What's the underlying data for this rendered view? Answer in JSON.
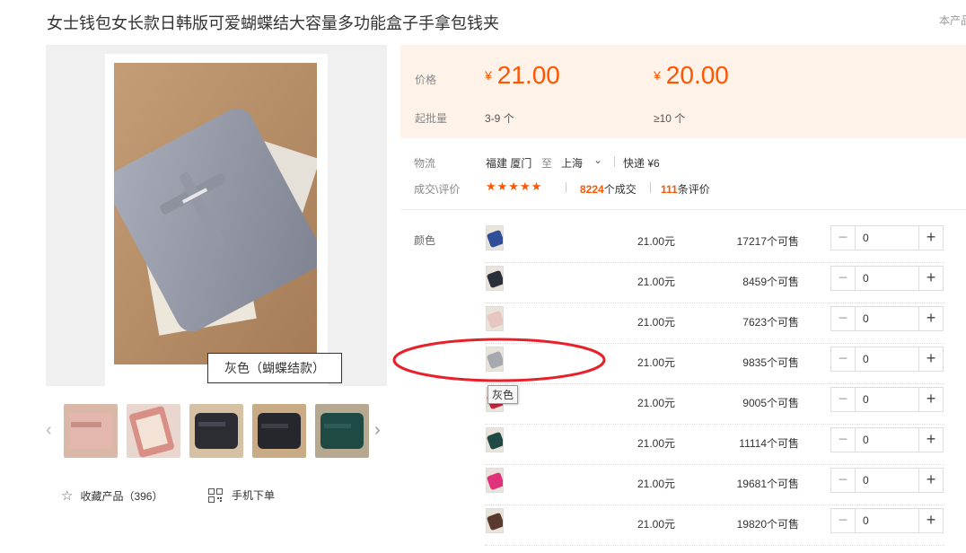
{
  "title": "女士钱包女长款日韩版可爱蝴蝶结大容量多功能盒子手拿包钱夹",
  "report_link": "本产品",
  "gallery": {
    "caption": "灰色（蝴蝶结款）",
    "thumbnails": [
      {
        "name": "pink-wallet"
      },
      {
        "name": "pink-open-wallet"
      },
      {
        "name": "black-wallet"
      },
      {
        "name": "black-wallet-2"
      },
      {
        "name": "green-wallet"
      }
    ]
  },
  "collect": {
    "label": "收藏产品（396）"
  },
  "mobile_order": {
    "label": "手机下单"
  },
  "price_panel": {
    "price_label": "价格",
    "moq_label": "起批量",
    "tiers": [
      {
        "currency": "¥",
        "price": "21.00",
        "range": "3-9 个"
      },
      {
        "currency": "¥",
        "price": "20.00",
        "range": "≥10 个"
      }
    ]
  },
  "logistics": {
    "label": "物流",
    "from": "福建 厦门",
    "to_word": "至",
    "dest": "上海",
    "express": "快递 ¥6"
  },
  "deals": {
    "label": "成交\\评价",
    "stars": "★★★★★",
    "deals_count": "8224",
    "deals_suffix": "个成交",
    "reviews_count": "111",
    "reviews_suffix": "条评价"
  },
  "variants": {
    "label": "颜色",
    "tooltip": "灰色",
    "rows": [
      {
        "color": "#2f4f9a",
        "price": "21.00元",
        "stock": "17217个可售",
        "qty": "0"
      },
      {
        "color": "#2b2f3a",
        "price": "21.00元",
        "stock": "8459个可售",
        "qty": "0"
      },
      {
        "color": "#e8c6c0",
        "price": "21.00元",
        "stock": "7623个可售",
        "qty": "0"
      },
      {
        "color": "#a7a9b0",
        "price": "21.00元",
        "stock": "9835个可售",
        "qty": "0"
      },
      {
        "color": "#c2263a",
        "price": "21.00元",
        "stock": "9005个可售",
        "qty": "0"
      },
      {
        "color": "#1f4a44",
        "price": "21.00元",
        "stock": "11114个可售",
        "qty": "0"
      },
      {
        "color": "#e0327a",
        "price": "21.00元",
        "stock": "19681个可售",
        "qty": "0"
      },
      {
        "color": "#5a3a2c",
        "price": "21.00元",
        "stock": "19820个可售",
        "qty": "0"
      }
    ]
  },
  "colors": {
    "accent": "#ff5500",
    "panel_bg": "#fff2e8",
    "annotation": "#e8202a"
  }
}
